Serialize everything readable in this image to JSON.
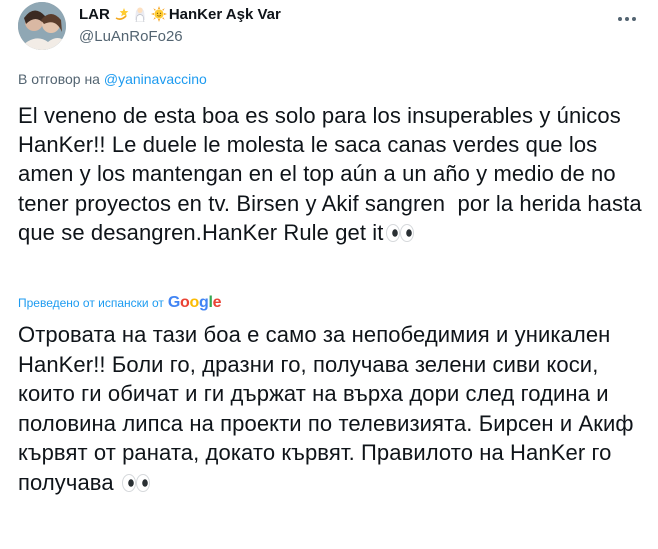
{
  "user": {
    "display_name": "LAR",
    "brand_name": "HanKer Aşk Var",
    "handle": "@LuAnRoFo26",
    "emojis": [
      "dizzy-star-icon",
      "wedding-couple-icon",
      "sun-with-face-icon"
    ]
  },
  "reply": {
    "prefix": "В отговор на",
    "mention": "@yaninavaccino"
  },
  "tweet": {
    "text": "El veneno de esta boa es solo para los insuperables y únicos HanKer!! Le duele le molesta le saca canas verdes que los amen y los mantengan en el top aún a un año y medio de no tener proyectos en tv. Birsen y Akif sangren  por la herida hasta que se desangren.HanKer Rule get it",
    "trailing_emoji": "eyes-icon"
  },
  "translation": {
    "notice": "Преведено от испански от",
    "provider": "Google",
    "text": "Отровата на тази боа е само за непобедимия и уникален HanKer!! Боли го, дразни го, получава зелени сиви коси, които ги обичат и ги държат на върха дори след година и половина липса на проекти по телевизията. Бирсен и Акиф кървят от раната, докато кървят. Правилото на HanKer го получава ",
    "trailing_emoji": "eyes-icon"
  },
  "colors": {
    "text": "#0f1419",
    "secondary": "#536471",
    "link": "#1d9bf0"
  }
}
